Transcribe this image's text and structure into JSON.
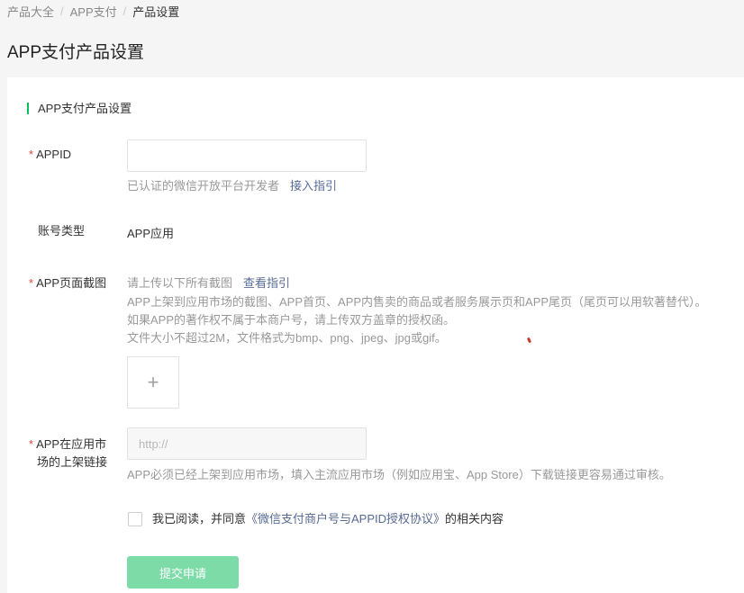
{
  "breadcrumb": {
    "items": [
      "产品大全",
      "APP支付"
    ],
    "current": "产品设置"
  },
  "page": {
    "title": "APP支付产品设置"
  },
  "section": {
    "title": "APP支付产品设置"
  },
  "form": {
    "required_mark": "*",
    "appid": {
      "label": "APPID",
      "value": "",
      "hint": "已认证的微信开放平台开发者",
      "hint_link": "接入指引"
    },
    "account_type": {
      "label": "账号类型",
      "value": "APP应用"
    },
    "screenshot": {
      "label": "APP页面截图",
      "hint_lead": "请上传以下所有截图",
      "hint_link": "查看指引",
      "desc_lines": [
        "APP上架到应用市场的截图、APP首页、APP内售卖的商品或者服务展示页和APP尾页（尾页可以用软著替代）。",
        "如果APP的著作权不属于本商户号，请上传双方盖章的授权函。",
        "文件大小不超过2M，文件格式为bmp、png、jpeg、jpg或gif。"
      ],
      "upload_symbol": "+"
    },
    "market_link": {
      "label_line1": "APP在应用市",
      "label_line2": "场的上架链接",
      "placeholder": "http://",
      "value": "",
      "hint": "APP必须已经上架到应用市场，填入主流应用市场（例如应用宝、App Store）下载链接更容易通过审核。"
    },
    "agreement": {
      "checked": false,
      "prefix": "我已阅读，并同意",
      "protocol": "《微信支付商户号与APPID授权协议》",
      "suffix": "的相关内容"
    },
    "submit_label": "提交申请"
  },
  "colors": {
    "accent": "#07c160",
    "submit_disabled": "#7ddba8",
    "link": "#576b95",
    "required": "#e64340"
  }
}
